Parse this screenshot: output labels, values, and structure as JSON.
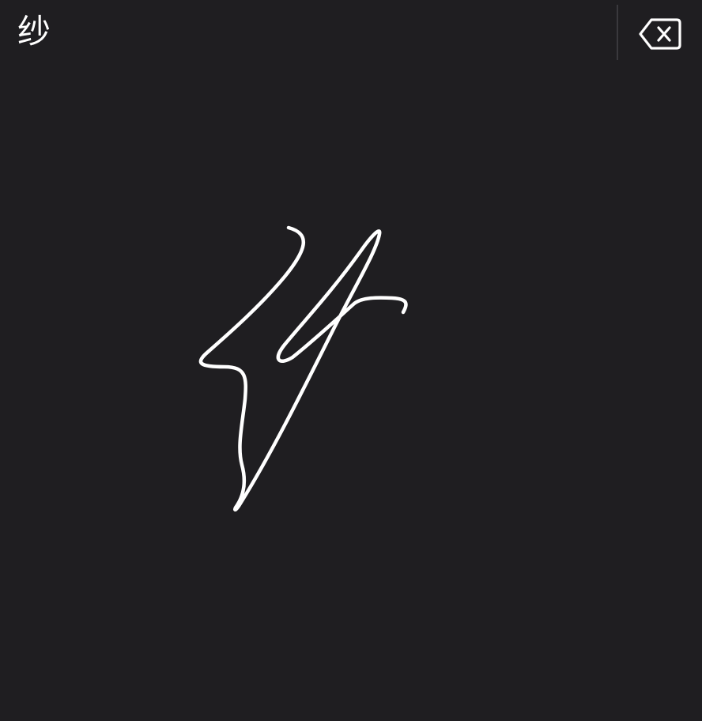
{
  "candidate_bar": {
    "candidates": [
      "纱"
    ]
  },
  "icons": {
    "delete": "delete-backspace-icon"
  },
  "colors": {
    "background": "#1f1e21",
    "ink": "#ffffff",
    "divider": "#3a393d"
  }
}
